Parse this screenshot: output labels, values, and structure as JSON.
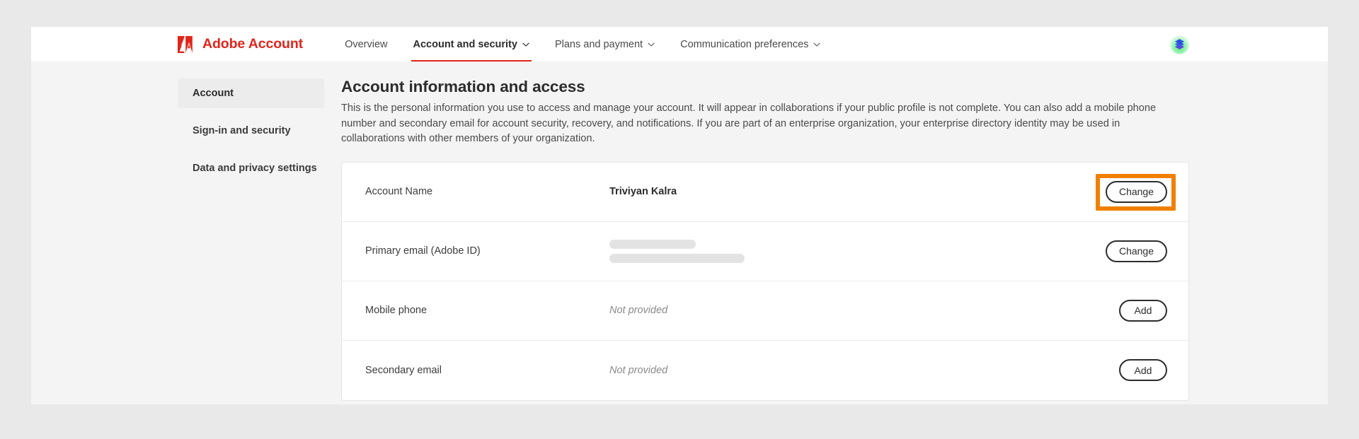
{
  "header": {
    "brand": "Adobe Account",
    "brand_color": "#e1251b",
    "logo_icon": "adobe-triangle-logo",
    "nav": [
      {
        "label": "Overview",
        "has_caret": false,
        "active": false
      },
      {
        "label": "Account and security",
        "has_caret": true,
        "active": true
      },
      {
        "label": "Plans and payment",
        "has_caret": true,
        "active": false
      },
      {
        "label": "Communication preferences",
        "has_caret": true,
        "active": false
      }
    ],
    "avatar_icon": "profile-avatar-layers"
  },
  "sidebar": {
    "items": [
      {
        "label": "Account",
        "active": true
      },
      {
        "label": "Sign-in and security",
        "active": false
      },
      {
        "label": "Data and privacy settings",
        "active": false
      }
    ]
  },
  "main": {
    "title": "Account information and access",
    "description": "This is the personal information you use to access and manage your account. It will appear in collaborations if your public profile is not complete. You can also add a mobile phone number and secondary email for account security, recovery, and notifications. If you are part of an enterprise organization, your enterprise directory identity may be used in collaborations with other members of your organization.",
    "rows": [
      {
        "label": "Account Name",
        "value": "Triviyan Kalra",
        "value_style": "bold",
        "action_label": "Change",
        "highlighted": true
      },
      {
        "label": "Primary email (Adobe ID)",
        "value": "",
        "value_style": "redacted",
        "action_label": "Change",
        "highlighted": false
      },
      {
        "label": "Mobile phone",
        "value": "Not provided",
        "value_style": "muted",
        "action_label": "Add",
        "highlighted": false
      },
      {
        "label": "Secondary email",
        "value": "Not provided",
        "value_style": "muted",
        "action_label": "Add",
        "highlighted": false
      }
    ]
  },
  "annotation": {
    "highlight_color": "#f08000",
    "target": "change-button-account-name"
  }
}
